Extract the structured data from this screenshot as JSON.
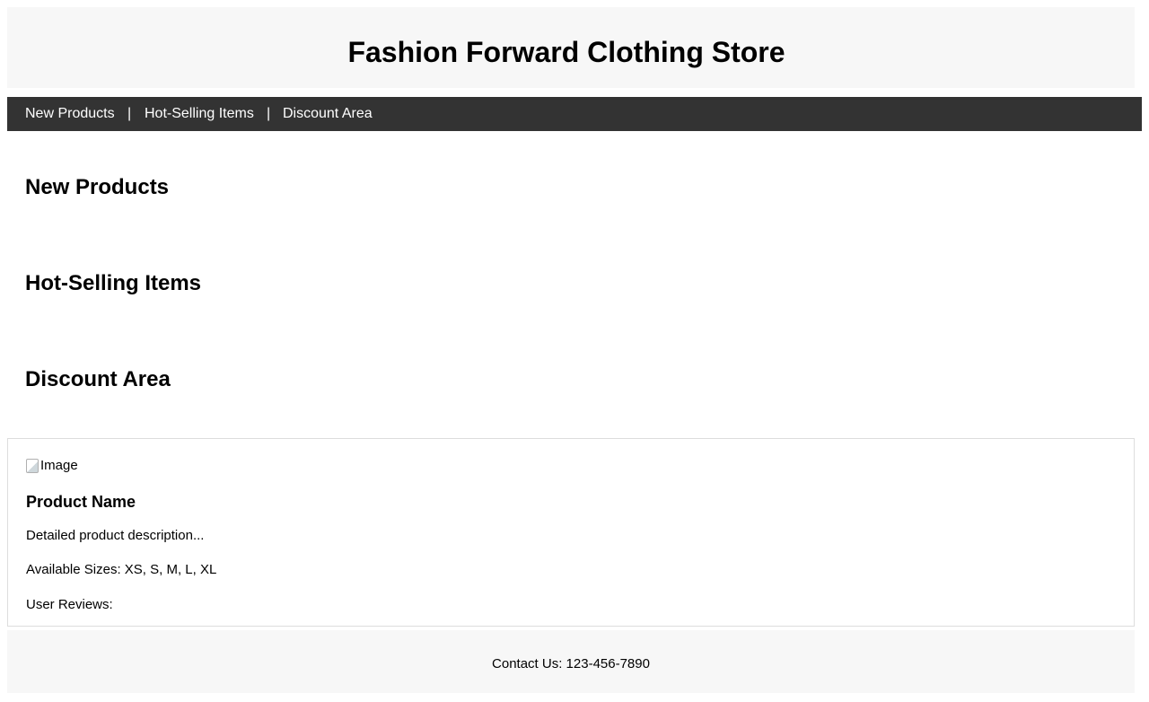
{
  "header": {
    "title": "Fashion Forward Clothing Store"
  },
  "nav": {
    "items": [
      {
        "label": "New Products"
      },
      {
        "label": "Hot-Selling Items"
      },
      {
        "label": "Discount Area"
      }
    ],
    "separator": "|"
  },
  "sections": {
    "new_products": {
      "title": "New Products"
    },
    "hot_selling": {
      "title": "Hot-Selling Items"
    },
    "discount": {
      "title": "Discount Area"
    }
  },
  "product": {
    "image_alt": "Image",
    "name": "Product Name",
    "description": "Detailed product description...",
    "sizes": "Available Sizes: XS, S, M, L, XL",
    "reviews": "User Reviews:"
  },
  "footer": {
    "contact": "Contact Us: 123-456-7890"
  }
}
